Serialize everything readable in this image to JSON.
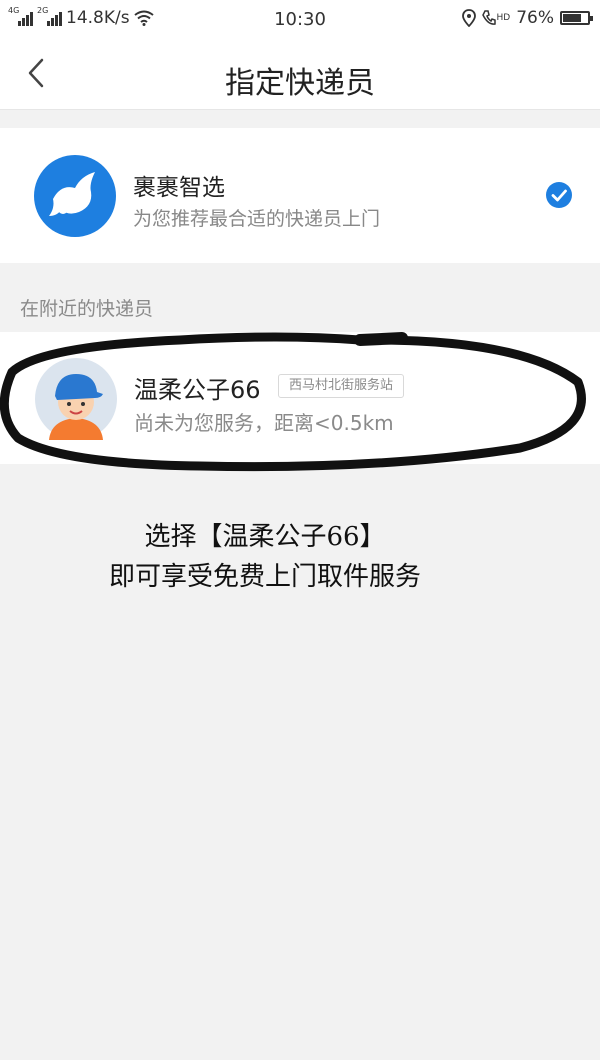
{
  "status_bar": {
    "network_speed": "14.8K/s",
    "time": "10:30",
    "battery": "76%",
    "battery_level": 0.76,
    "sim1_tag": "4G",
    "sim2_tag": "2G",
    "hd_tag": "HD"
  },
  "header": {
    "title": "指定快递员"
  },
  "smart_pick": {
    "name": "裹裹智选",
    "description": "为您推荐最合适的快递员上门",
    "selected": true,
    "accent_color": "#1e7fe0"
  },
  "nearby": {
    "section_label": "在附近的快递员",
    "couriers": [
      {
        "name": "温柔公子66",
        "station": "西马村北街服务站",
        "status": "尚未为您服务，距离<0.5km"
      }
    ]
  },
  "annotation": {
    "line1": "选择【温柔公子66】",
    "line2": "即可享受免费上门取件服务"
  }
}
